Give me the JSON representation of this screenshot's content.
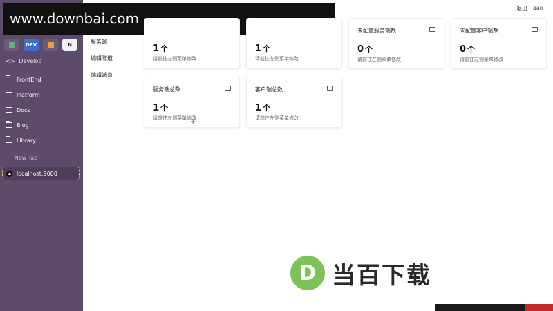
{
  "watermark": {
    "site": "www.downbai.com",
    "brand_letter": "D",
    "brand_name": "当百下载"
  },
  "header": {
    "logout": "退出",
    "user": "aali"
  },
  "sidebar": {
    "top_icons": [
      {
        "label": "",
        "color": "#5fb37a"
      },
      {
        "label": "DEV",
        "color": "#3a6fd6"
      },
      {
        "label": "",
        "color": "#e8a33c"
      },
      {
        "label": "N",
        "color": "#ffffff"
      }
    ],
    "develop": "Develop",
    "folders": [
      "FrontEnd",
      "Platform",
      "Docs",
      "Blog",
      "Library"
    ],
    "new_tab": "New Tab",
    "active_tab": "localhost:9000"
  },
  "subnav": [
    "服务端",
    "编辑隧道",
    "编辑端点"
  ],
  "cards": [
    {
      "title": "",
      "value": "1",
      "unit": "个",
      "hint": "请前往左侧菜单修改"
    },
    {
      "title": "",
      "value": "1",
      "unit": "个",
      "hint": "请前往左侧菜单修改"
    },
    {
      "title": "未配置服务端数",
      "value": "0",
      "unit": "个",
      "hint": "请前往左侧菜单修改"
    },
    {
      "title": "未配置客户端数",
      "value": "0",
      "unit": "个",
      "hint": "请前往左侧菜单修改"
    },
    {
      "title": "服务端总数",
      "value": "1",
      "unit": "个",
      "hint": "请前往左侧菜单修改"
    },
    {
      "title": "客户端总数",
      "value": "1",
      "unit": "个",
      "hint": "请前往左侧菜单修改"
    }
  ]
}
